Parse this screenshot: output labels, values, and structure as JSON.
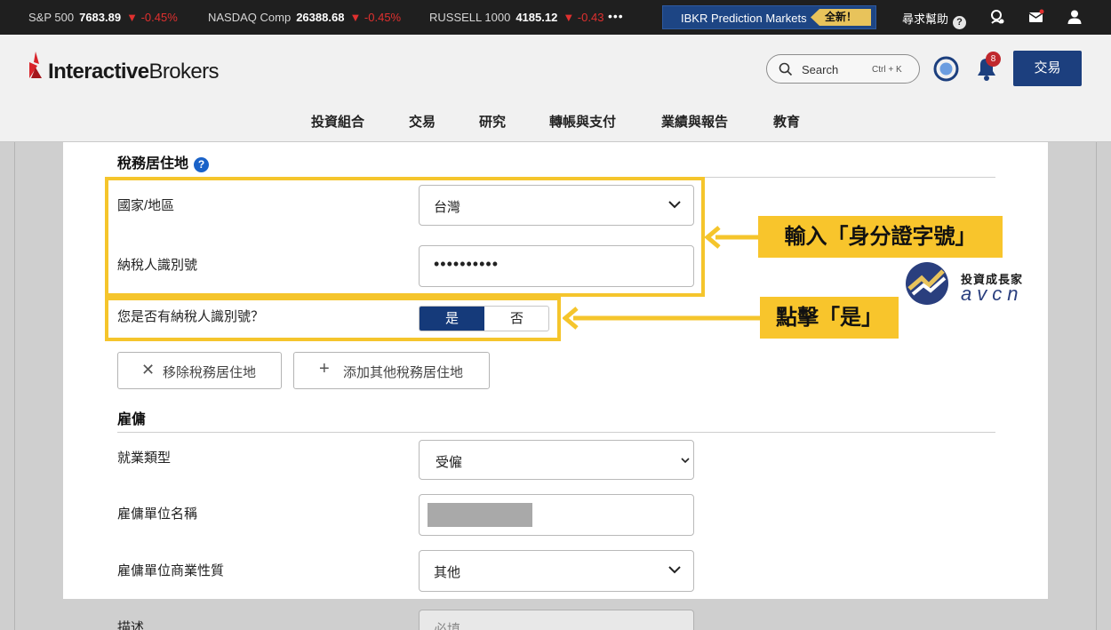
{
  "ticker": {
    "items": [
      {
        "name": "S&P 500",
        "value": "7683.89",
        "change": "-0.45%"
      },
      {
        "name": "NASDAQ Comp",
        "value": "26388.68",
        "change": "-0.45%"
      },
      {
        "name": "RUSSELL 1000",
        "value": "4185.12",
        "change": "-0.43"
      }
    ],
    "more": "•••",
    "promo_label": "IBKR Prediction Markets",
    "promo_badge": "全新！",
    "help_label": "尋求幫助",
    "help_icon": "question-circle-icon"
  },
  "header": {
    "logo_bold": "Interactive",
    "logo_rest": "Brokers",
    "search_placeholder": "Search",
    "search_shortcut": "Ctrl + K",
    "notification_count": "8",
    "trade_button": "交易",
    "nav": [
      "投資組合",
      "交易",
      "研究",
      "轉帳與支付",
      "業績與報告",
      "教育"
    ]
  },
  "tax": {
    "title": "稅務居住地",
    "help_mark": "?",
    "country_label": "國家/地區",
    "country_value": "台灣",
    "tin_label": "納稅人識別號",
    "tin_value": "••••••••••",
    "has_tin_label": "您是否有納稅人識別號？",
    "yes_label": "是",
    "no_label": "否",
    "selected": "是",
    "remove_button": "移除稅務居住地",
    "add_button": "添加其他稅務居住地"
  },
  "employment": {
    "title": "雇傭",
    "type_label": "就業類型",
    "type_value": "受僱",
    "employer_label": "雇傭單位名稱",
    "business_label": "雇傭單位商業性質",
    "business_value": "其他",
    "desc_label": "描述",
    "desc_placeholder": "必填"
  },
  "annotations": {
    "callout_tin": "輸入「身分證字號」",
    "callout_yes": "點擊「是」",
    "watermark_title": "投資成長家",
    "watermark_brand": "avcn",
    "color": "#f5c52c"
  }
}
